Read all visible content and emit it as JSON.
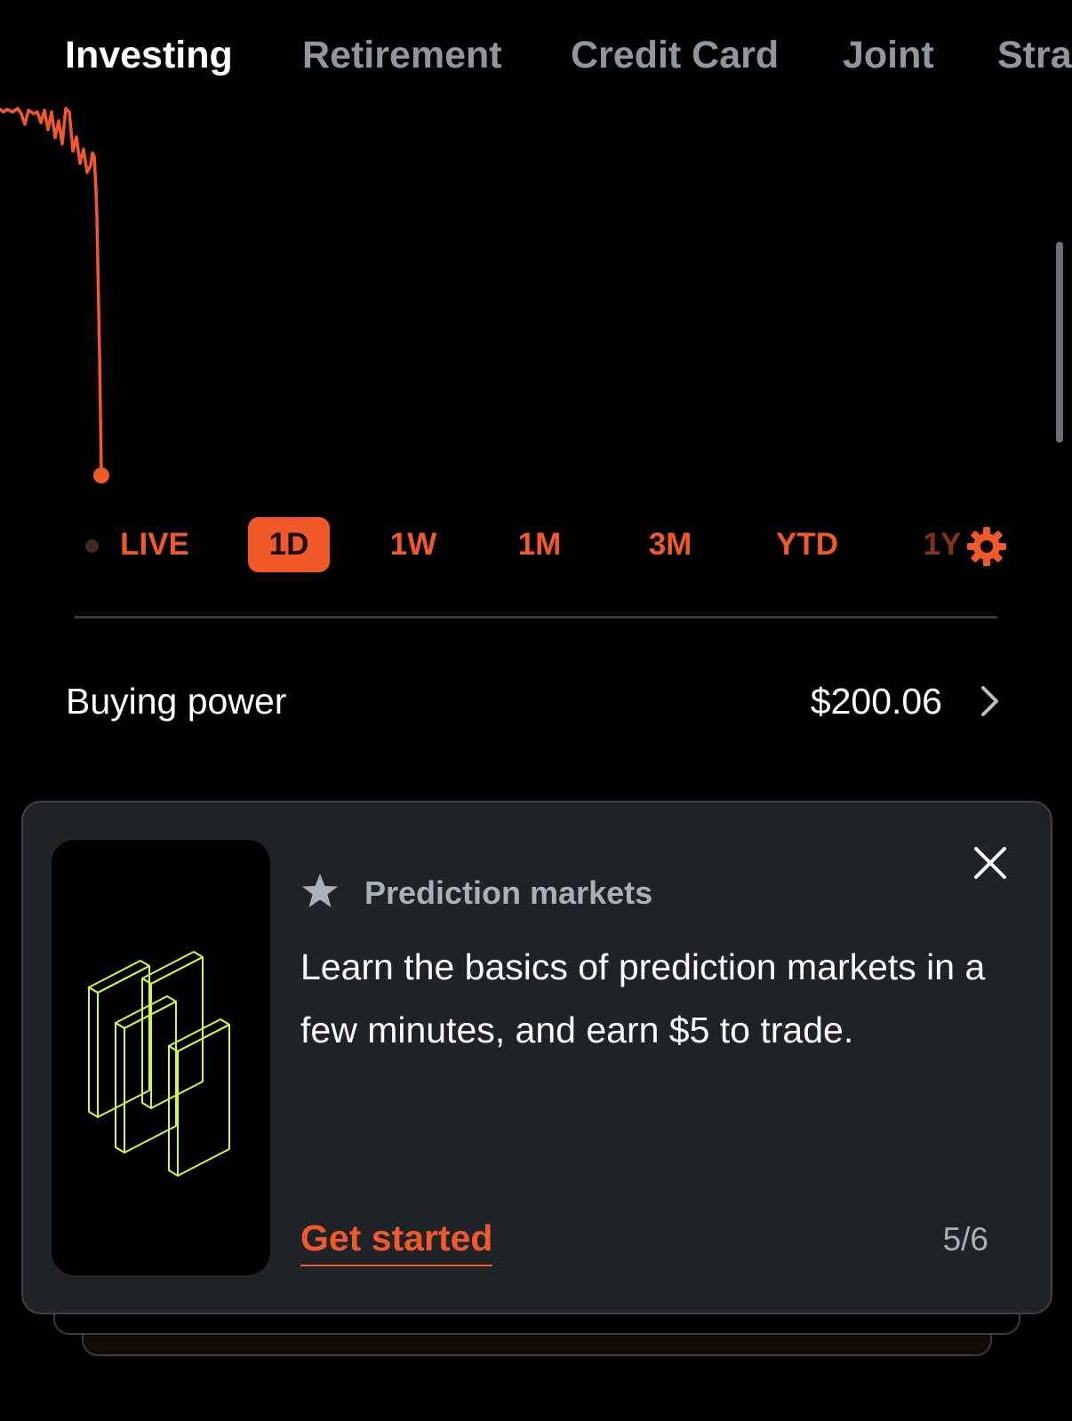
{
  "tabs": {
    "items": [
      {
        "label": "Investing",
        "active": true
      },
      {
        "label": "Retirement",
        "active": false
      },
      {
        "label": "Credit Card",
        "active": false
      },
      {
        "label": "Joint",
        "active": false
      },
      {
        "label": "Stra",
        "active": false
      }
    ]
  },
  "chart": {
    "line_color": "#f0592a",
    "trend": "sharp drop after a choppy start, ending at the low point"
  },
  "spans": {
    "live_label": "LIVE",
    "items": [
      "1D",
      "1W",
      "1M",
      "3M",
      "YTD",
      "1Y"
    ],
    "selected": "1D",
    "settings_icon": "gear-icon"
  },
  "buying_power": {
    "label": "Buying power",
    "value": "$200.06",
    "chevron_icon": "chevron-right-icon"
  },
  "promo_card": {
    "eyebrow_icon": "star-icon",
    "eyebrow": "Prediction markets",
    "body": "Learn the basics of prediction markets in a few minutes, and earn $5 to trade.",
    "cta": "Get started",
    "pager": "5/6",
    "close_icon": "close-icon",
    "illustration": "isometric-blocks-illustration"
  },
  "colors": {
    "accent": "#f0592a",
    "background": "#000000",
    "card_background": "#1f2226",
    "muted_text": "#8e969e",
    "illustration_stroke": "#d7f542"
  }
}
